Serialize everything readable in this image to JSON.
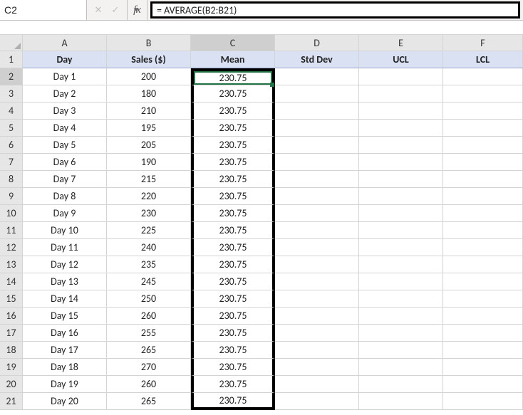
{
  "nameBox": {
    "value": "C2"
  },
  "formulaBar": {
    "fx_label": "fx",
    "formula": "= AVERAGE(B2:B21)"
  },
  "columns": [
    "A",
    "B",
    "C",
    "D",
    "E",
    "F"
  ],
  "headerRow": {
    "A": "Day",
    "B": "Sales ($)",
    "C": "Mean",
    "D": "Std Dev",
    "E": "UCL",
    "F": "LCL"
  },
  "rows": [
    {
      "n": 2,
      "A": "Day 1",
      "B": "200",
      "C": "230.75"
    },
    {
      "n": 3,
      "A": "Day 2",
      "B": "180",
      "C": "230.75"
    },
    {
      "n": 4,
      "A": "Day 3",
      "B": "210",
      "C": "230.75"
    },
    {
      "n": 5,
      "A": "Day 4",
      "B": "195",
      "C": "230.75"
    },
    {
      "n": 6,
      "A": "Day 5",
      "B": "205",
      "C": "230.75"
    },
    {
      "n": 7,
      "A": "Day 6",
      "B": "190",
      "C": "230.75"
    },
    {
      "n": 8,
      "A": "Day 7",
      "B": "215",
      "C": "230.75"
    },
    {
      "n": 9,
      "A": "Day 8",
      "B": "220",
      "C": "230.75"
    },
    {
      "n": 10,
      "A": "Day 9",
      "B": "230",
      "C": "230.75"
    },
    {
      "n": 11,
      "A": "Day 10",
      "B": "225",
      "C": "230.75"
    },
    {
      "n": 12,
      "A": "Day 11",
      "B": "240",
      "C": "230.75"
    },
    {
      "n": 13,
      "A": "Day 12",
      "B": "235",
      "C": "230.75"
    },
    {
      "n": 14,
      "A": "Day 13",
      "B": "245",
      "C": "230.75"
    },
    {
      "n": 15,
      "A": "Day 14",
      "B": "250",
      "C": "230.75"
    },
    {
      "n": 16,
      "A": "Day 15",
      "B": "260",
      "C": "230.75"
    },
    {
      "n": 17,
      "A": "Day 16",
      "B": "255",
      "C": "230.75"
    },
    {
      "n": 18,
      "A": "Day 17",
      "B": "265",
      "C": "230.75"
    },
    {
      "n": 19,
      "A": "Day 18",
      "B": "270",
      "C": "230.75"
    },
    {
      "n": 20,
      "A": "Day 19",
      "B": "260",
      "C": "230.75"
    },
    {
      "n": 21,
      "A": "Day 20",
      "B": "265",
      "C": "230.75"
    }
  ]
}
